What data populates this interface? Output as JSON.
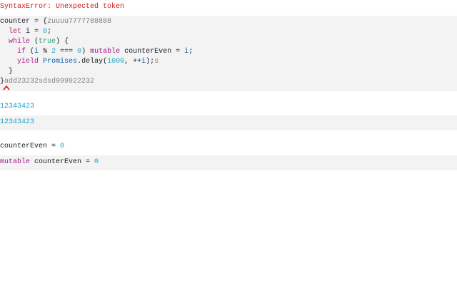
{
  "error": {
    "message": "SyntaxError: Unexpected token"
  },
  "code": {
    "l1_a": "counter = {",
    "l1_b": "zuuuu7777788888",
    "l2_indent": "  ",
    "l2_kw": "let",
    "l2_rest": " i = ",
    "l2_num": "0",
    "l2_end": ";",
    "l3_indent": "  ",
    "l3_kw": "while",
    "l3_a": " (",
    "l3_lit": "true",
    "l3_b": ") {",
    "l4_indent": "    ",
    "l4_kw": "if",
    "l4_a": " (",
    "l4_i": "i",
    "l4_b": " % ",
    "l4_n1": "2",
    "l4_c": " === ",
    "l4_n2": "0",
    "l4_d": ") ",
    "l4_kw2": "mutable",
    "l4_e": " counterEven = ",
    "l4_i2": "i",
    "l4_f": ";",
    "l5_indent": "    ",
    "l5_kw": "yield",
    "l5_sp": " ",
    "l5_obj": "Promises",
    "l5_a": ".delay(",
    "l5_n": "1000",
    "l5_b": ", ++",
    "l5_i": "i",
    "l5_c": ");",
    "l5_tail": "s",
    "l6": "  }",
    "l7_a": "}",
    "l7_b": "add23232sdsd999922232"
  },
  "outputs": {
    "o1": "12343423",
    "o2": "12343423",
    "o3_name": "counterEven",
    "o3_eq": " = ",
    "o3_val": "0",
    "o4_kw": "mutable",
    "o4_name": " counterEven",
    "o4_eq": " = ",
    "o4_val": "0"
  },
  "colors": {
    "error": "#d01818",
    "keyword": "#b5218a",
    "number": "#1aa3c7",
    "literal": "#2d9e7a",
    "builtin": "#0b5fad",
    "muted": "#808080",
    "cell_bg": "#f3f3f3"
  }
}
